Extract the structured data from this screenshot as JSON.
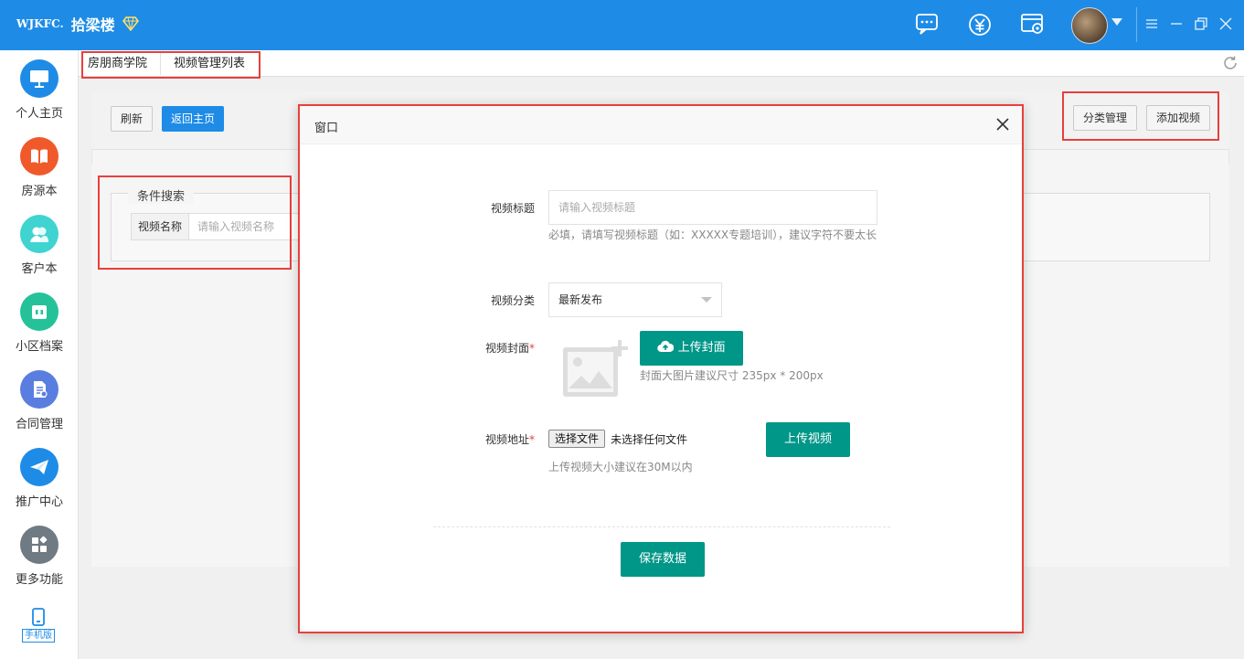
{
  "header": {
    "logo_text": "WJKFC.",
    "app_name": "拾梁楼",
    "icons": [
      "chat-icon",
      "yuan-icon",
      "settings-window-icon"
    ]
  },
  "sidebar": {
    "items": [
      {
        "label": "个人主页",
        "icon": "monitor-icon",
        "color": "#1e8ce6"
      },
      {
        "label": "房源本",
        "icon": "book-icon",
        "color": "#f05a2a"
      },
      {
        "label": "客户本",
        "icon": "people-icon",
        "color": "#3fd4d0"
      },
      {
        "label": "小区档案",
        "icon": "building-icon",
        "color": "#25c29a"
      },
      {
        "label": "合同管理",
        "icon": "contract-icon",
        "color": "#5a7ee0"
      },
      {
        "label": "推广中心",
        "icon": "paper-plane-icon",
        "color": "#1e8ce6"
      },
      {
        "label": "更多功能",
        "icon": "grid-icon",
        "color": "#707a82"
      }
    ],
    "mobile_label": "手机版"
  },
  "tabs": [
    {
      "label": "房朋商学院"
    },
    {
      "label": "视频管理列表"
    }
  ],
  "toolbar": {
    "refresh_label": "刷新",
    "home_label": "返回主页",
    "category_label": "分类管理",
    "add_video_label": "添加视频"
  },
  "search": {
    "legend": "条件搜索",
    "label": "视频名称",
    "placeholder": "请输入视频名称"
  },
  "modal": {
    "title": "窗口",
    "fields": {
      "title_label": "视频标题",
      "title_placeholder": "请输入视频标题",
      "title_hint": "必填，请填写视频标题（如：XXXXX专题培训），建议字符不要太长",
      "category_label": "视频分类",
      "category_value": "最新发布",
      "cover_label": "视频封面",
      "cover_button": "上传封面",
      "cover_hint": "封面大图片建议尺寸 235px * 200px",
      "url_label": "视频地址",
      "file_button": "选择文件",
      "file_status": "未选择任何文件",
      "upload_video_button": "上传视频",
      "url_hint": "上传视频大小建议在30M以内"
    },
    "save_button": "保存数据",
    "required_mark": "*"
  },
  "colors": {
    "primary": "#1e8ce6",
    "green": "#009688",
    "highlight": "#e8403c"
  }
}
